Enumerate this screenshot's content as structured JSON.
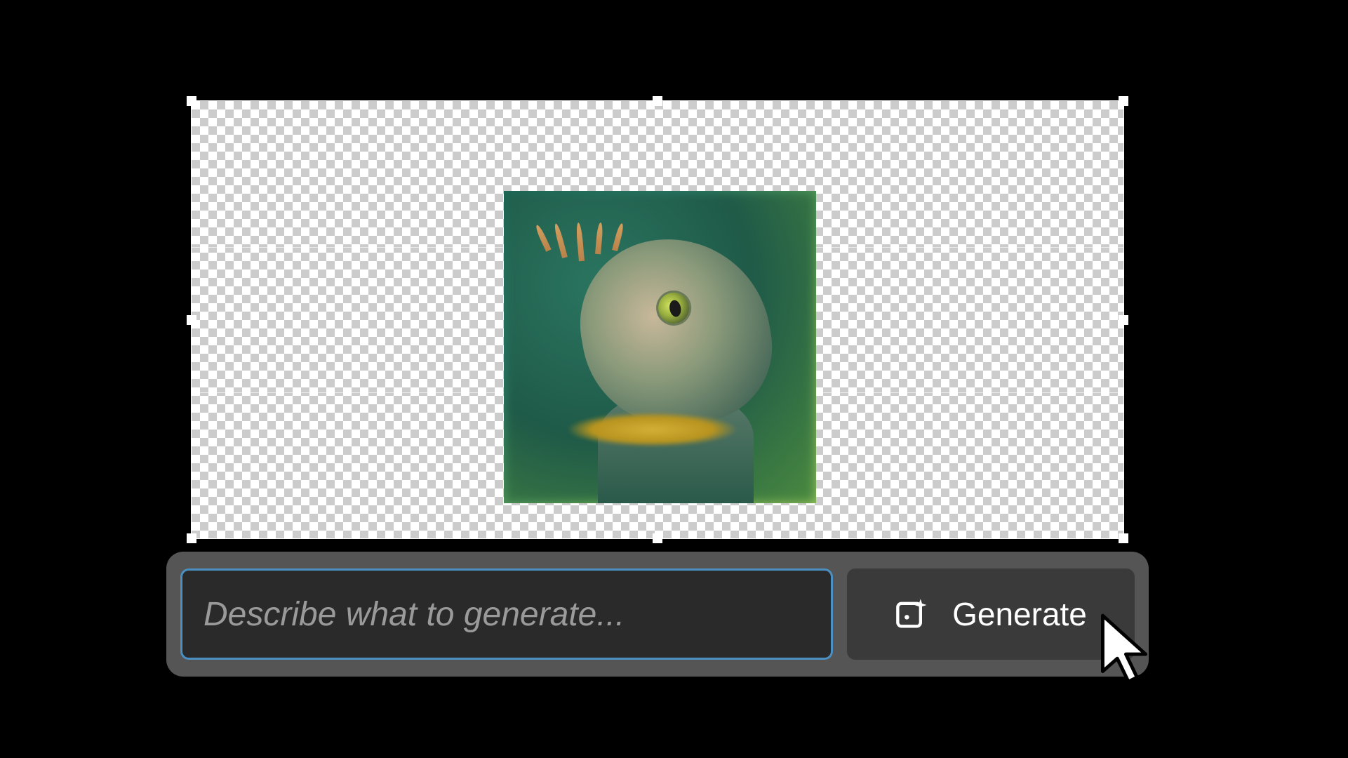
{
  "canvas": {
    "content_description": "iguana-lizard-image"
  },
  "promptBar": {
    "input_placeholder": "Describe what to generate...",
    "input_value": "",
    "generate_label": "Generate",
    "generate_icon": "generative-fill-sparkle-icon"
  }
}
